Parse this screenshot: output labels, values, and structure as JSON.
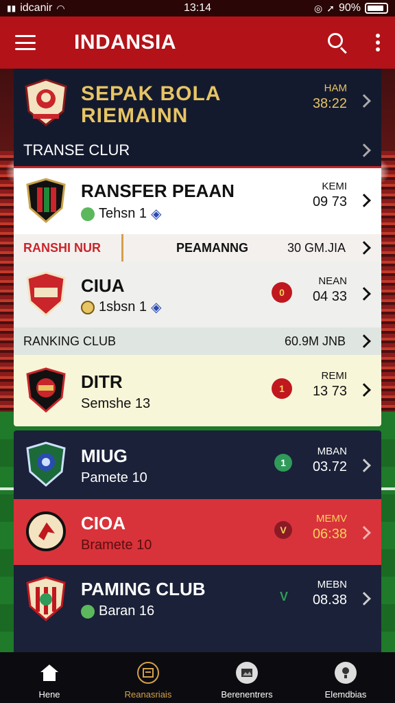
{
  "status_bar": {
    "carrier": "idcanir",
    "time": "13:14",
    "battery": "90%",
    "battery_level": 0.9
  },
  "app_bar": {
    "title": "INDANSIA"
  },
  "hero": {
    "title_line1": "SEPAK BOLA",
    "title_line2": "RIEMAINN",
    "stat_label": "HAM",
    "stat_value": "38:22",
    "subheader": "TRANSE CLUR"
  },
  "rows": [
    {
      "name": "RANSFER PEAAN",
      "sub": "Tehsn 1",
      "stat_label": "KEMI",
      "stat_value": "09 73"
    },
    {
      "name": "CIUA",
      "sub": "1sbsn 1",
      "badge": "0",
      "stat_label": "NEAN",
      "stat_value": "04 33"
    },
    {
      "name": "DITR",
      "sub": "Semshe 13",
      "badge": "1",
      "stat_label": "REMI",
      "stat_value": "13 73"
    },
    {
      "name": "MIUG",
      "sub": "Pamete 10",
      "badge": "1",
      "stat_label": "MBAN",
      "stat_value": "03.72"
    },
    {
      "name": "CIOA",
      "sub": "Bramete 10",
      "badge": "V",
      "stat_label": "MEMV",
      "stat_value": "06:38"
    },
    {
      "name": "PAMING CLUB",
      "sub": "Baran 16",
      "badge": "V",
      "stat_label": "MEBN",
      "stat_value": "08.38"
    }
  ],
  "subbars": [
    {
      "left": "RANSHI NUR",
      "mid": "PEAMANNG",
      "right": "30 GM.JIA"
    },
    {
      "left": "RANKING CLUB",
      "right": "60.9M JNB"
    }
  ],
  "bottom_nav": [
    {
      "label": "Hene",
      "icon": "home-icon"
    },
    {
      "label": "Reanasriais",
      "icon": "list-icon"
    },
    {
      "label": "Berenentrers",
      "icon": "image-icon"
    },
    {
      "label": "Elemdbias",
      "icon": "info-icon"
    }
  ],
  "colors": {
    "appbar": "#b31218",
    "navy": "#141a2e",
    "gold": "#e7c464",
    "red_row": "#d8333a",
    "cream_row": "#f8f6d8",
    "active_nav": "#d4a04a"
  }
}
